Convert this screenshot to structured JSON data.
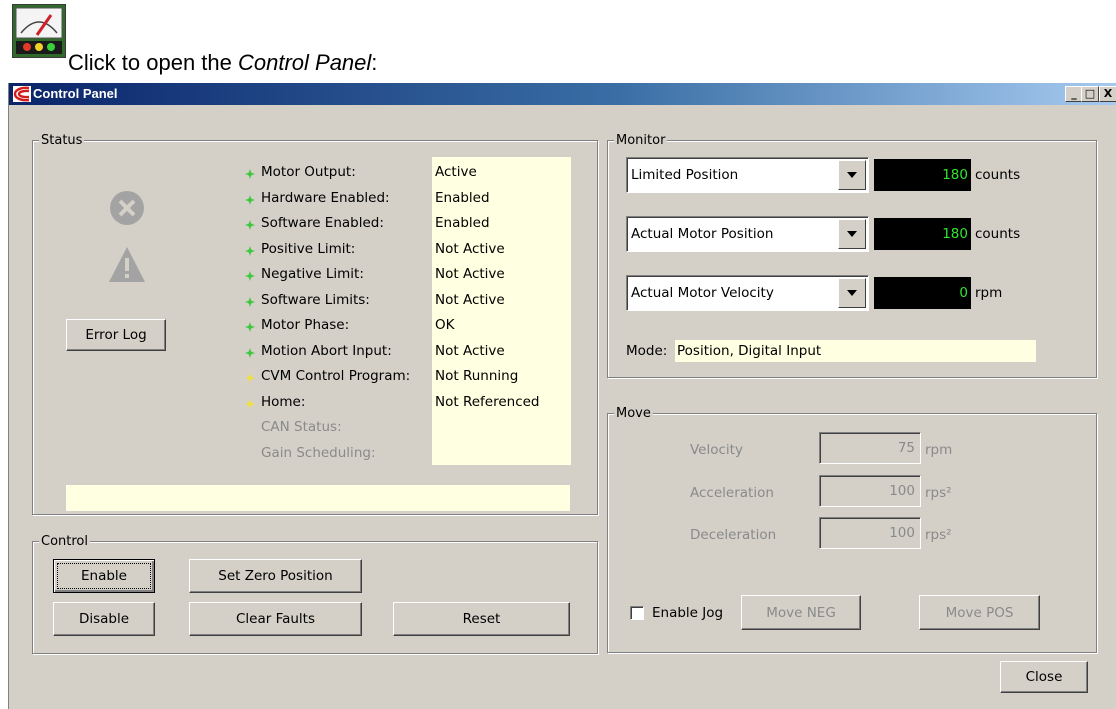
{
  "intro": {
    "prefix": "Click to open the ",
    "emphasis": "Control Panel",
    "suffix": ":"
  },
  "window": {
    "title": "Control Panel",
    "caption_buttons": {
      "minimize": "_",
      "maximize": "□",
      "close": "X"
    }
  },
  "status": {
    "legend": "Status",
    "error_log_label": "Error Log",
    "rows": [
      {
        "label": "Motor Output:",
        "value": "Active",
        "indicator": "green"
      },
      {
        "label": "Hardware Enabled:",
        "value": "Enabled",
        "indicator": "green"
      },
      {
        "label": "Software Enabled:",
        "value": "Enabled",
        "indicator": "green"
      },
      {
        "label": "Positive Limit:",
        "value": "Not Active",
        "indicator": "green"
      },
      {
        "label": "Negative Limit:",
        "value": "Not Active",
        "indicator": "green"
      },
      {
        "label": "Software Limits:",
        "value": "Not Active",
        "indicator": "green"
      },
      {
        "label": "Motor Phase:",
        "value": "OK",
        "indicator": "green"
      },
      {
        "label": "Motion Abort Input:",
        "value": "Not Active",
        "indicator": "green"
      },
      {
        "label": "CVM Control Program:",
        "value": "Not Running",
        "indicator": "yellow"
      },
      {
        "label": "Home:",
        "value": "Not Referenced",
        "indicator": "yellow"
      },
      {
        "label": "CAN Status:",
        "value": "",
        "indicator": "none"
      },
      {
        "label": "Gain Scheduling:",
        "value": "",
        "indicator": "none"
      }
    ],
    "message": ""
  },
  "control": {
    "legend": "Control",
    "enable_label": "Enable",
    "set_zero_label": "Set Zero Position",
    "disable_label": "Disable",
    "clear_faults_label": "Clear Faults",
    "reset_label": "Reset"
  },
  "monitor": {
    "legend": "Monitor",
    "channels": [
      {
        "select": "Limited Position",
        "value": "180",
        "unit": "counts"
      },
      {
        "select": "Actual Motor Position",
        "value": "180",
        "unit": "counts"
      },
      {
        "select": "Actual Motor Velocity",
        "value": "0",
        "unit": "rpm"
      }
    ],
    "mode_label": "Mode:",
    "mode_value": "Position, Digital Input"
  },
  "move": {
    "legend": "Move",
    "velocity_label": "Velocity",
    "velocity_value": "75",
    "velocity_unit": "rpm",
    "acceleration_label": "Acceleration",
    "acceleration_value": "100",
    "acceleration_unit": "rps²",
    "deceleration_label": "Deceleration",
    "deceleration_value": "100",
    "deceleration_unit": "rps²",
    "enable_jog_label": "Enable Jog",
    "move_neg_label": "Move NEG",
    "move_pos_label": "Move POS"
  },
  "close_label": "Close",
  "colors": {
    "indicator_green": "#3cc83c",
    "indicator_yellow": "#f0e040",
    "lcd_text": "#2ee62e"
  }
}
